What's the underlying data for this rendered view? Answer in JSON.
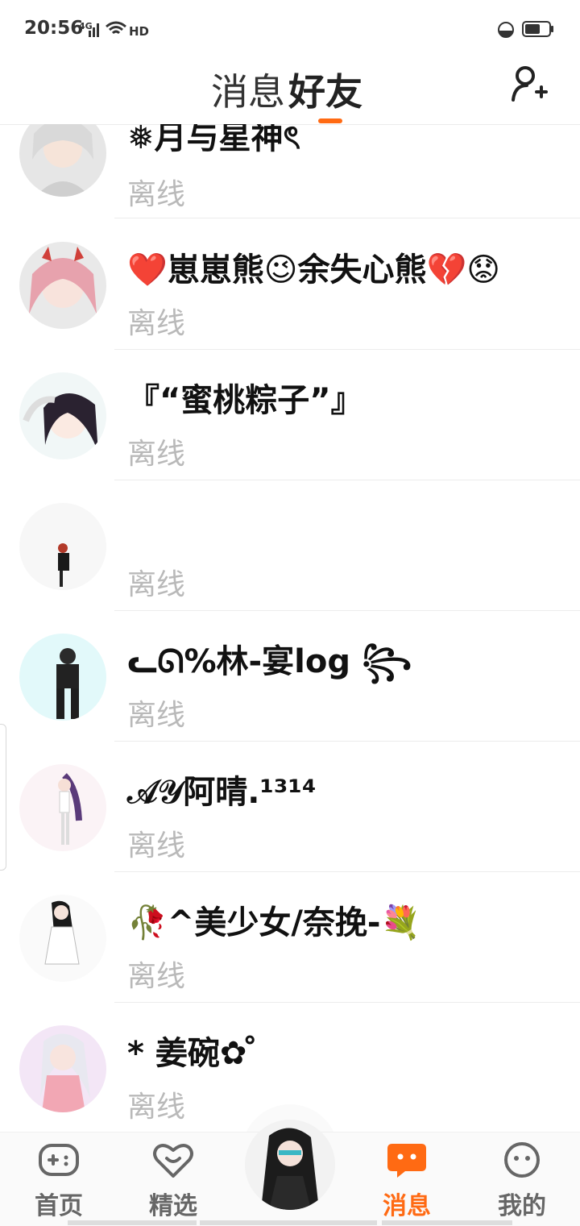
{
  "status_bar": {
    "time": "20:56",
    "network": "4G",
    "hd": "HD"
  },
  "header": {
    "tab_messages": "消息",
    "tab_friends": "好友"
  },
  "friends": [
    {
      "name": "❅月与星神ৎ",
      "status": "离线"
    },
    {
      "name": "❤️崽崽熊😉余失心熊💔😟",
      "status": "离线"
    },
    {
      "name": "『“蜜桃粽子”』",
      "status": "离线"
    },
    {
      "name": "",
      "status": "离线"
    },
    {
      "name": "ᓚᘏ%林-宴log ꧂",
      "status": "离线"
    },
    {
      "name": "𝒜𝒴阿晴.¹³¹⁴",
      "status": "离线"
    },
    {
      "name": "🥀^美少女/奈挽-💐",
      "status": "离线"
    },
    {
      "name": " * 姜碗✿ ̊",
      "status": "离线"
    }
  ],
  "bottom_nav": {
    "home": "首页",
    "featured": "精选",
    "messages": "消息",
    "mine": "我的"
  },
  "colors": {
    "accent": "#ff6a13",
    "status_text": "#b9b9b9"
  }
}
